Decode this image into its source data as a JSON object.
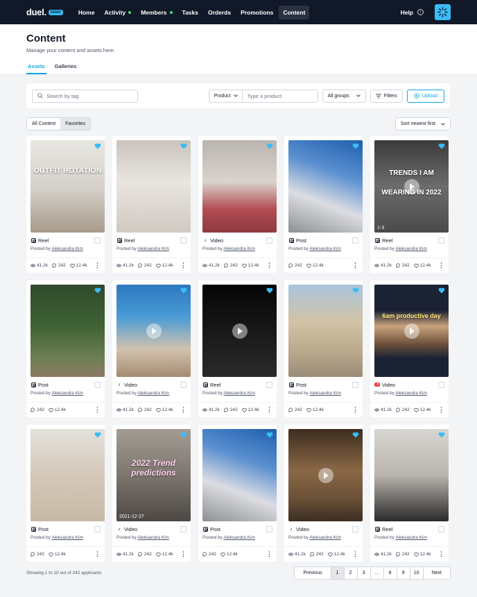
{
  "nav": {
    "logo": "duel.",
    "badge": "DEMO",
    "items": [
      {
        "label": "Home",
        "dot": false,
        "active": false
      },
      {
        "label": "Activity",
        "dot": true,
        "active": false
      },
      {
        "label": "Members",
        "dot": true,
        "active": false
      },
      {
        "label": "Tasks",
        "dot": false,
        "active": false
      },
      {
        "label": "Orderds",
        "dot": false,
        "active": false
      },
      {
        "label": "Promotions",
        "dot": false,
        "active": false
      },
      {
        "label": "Content",
        "dot": false,
        "active": true
      }
    ],
    "help": "Help"
  },
  "header": {
    "title": "Content",
    "subtitle": "Manage your content and assets here.",
    "tabs": [
      {
        "label": "Assets",
        "active": true
      },
      {
        "label": "Galleries",
        "active": false
      }
    ]
  },
  "filters": {
    "search_placeholder": "Search by tag",
    "product_label": "Product",
    "product_placeholder": "Type a product",
    "groups_label": "All groups",
    "filters_label": "Filters",
    "upload_label": "Upload"
  },
  "toggle": {
    "all": "All Content",
    "favorites": "Favorites"
  },
  "sort": {
    "label": "Sort newest first"
  },
  "posted_prefix": "Posted by",
  "cards": [
    {
      "type": "Reel",
      "platform": "instagram",
      "author": "Aleksandra Kim",
      "views": "41.2k",
      "comments": "242",
      "likes": "12.4k",
      "overlay": "OUTFIT ROTATION",
      "corner": "",
      "play": false,
      "bg": "linear-gradient(180deg,#e8e6e2 0%,#d6d2cb 50%,#a89c8c 100%)"
    },
    {
      "type": "Reel",
      "platform": "instagram",
      "author": "Aleksandra Kim",
      "views": "41.2k",
      "comments": "242",
      "likes": "12.4k",
      "overlay": "",
      "corner": "",
      "play": false,
      "bg": "linear-gradient(180deg,#c9c3bc 0%,#e9e5df 45%,#cfc9c1 100%)"
    },
    {
      "type": "Video",
      "platform": "tiktok",
      "author": "Aleksandra Kim",
      "views": "41.2k",
      "comments": "242",
      "likes": "12.4k",
      "overlay": "",
      "corner": "",
      "play": false,
      "bg": "linear-gradient(180deg,#b9b4ae 0%,#d9d3cc 45%,#b24c52 75%,#8e3a40 100%)"
    },
    {
      "type": "Post",
      "platform": "instagram",
      "author": "Aleksandra Kim",
      "views": "",
      "comments": "242",
      "likes": "12.4k",
      "overlay": "",
      "corner": "",
      "play": false,
      "bg": "linear-gradient(200deg,#1f5fae 0%,#5b90d0 35%,#dcdde2 65%,#8c8f93 100%)"
    },
    {
      "type": "Reel",
      "platform": "instagram",
      "author": "Aleksandra Kim",
      "views": "41.2k",
      "comments": "242",
      "likes": "12.4k",
      "overlay": "TRENDS I AM WEARING IN 2022",
      "corner": "1-3",
      "play": true,
      "bg": "linear-gradient(180deg,#3b3b3b 0%,#6c6c6c 50%,#4a4a4a 100%)"
    },
    {
      "type": "Post",
      "platform": "instagram",
      "author": "Aleksandra Kim",
      "views": "",
      "comments": "242",
      "likes": "12.4k",
      "overlay": "",
      "corner": "",
      "play": false,
      "bg": "linear-gradient(180deg,#2f4a2b 0%,#3f6234 45%,#6e7f55 80%,#8c7a62 100%)"
    },
    {
      "type": "Video",
      "platform": "tiktok",
      "author": "Aleksandra Kim",
      "views": "41.2k",
      "comments": "242",
      "likes": "12.4k",
      "overlay": "",
      "corner": "",
      "play": true,
      "bg": "linear-gradient(180deg,#2d78c0 0%,#4a9bd6 35%,#d2c2ae 70%,#a48b71 100%)"
    },
    {
      "type": "Reel",
      "platform": "instagram",
      "author": "Aleksandra Kim",
      "views": "41.2k",
      "comments": "242",
      "likes": "12.4k",
      "overlay": "",
      "corner": "",
      "play": true,
      "bg": "linear-gradient(180deg,#050505 0%,#1a1a1a 55%,#2a2a2a 100%)"
    },
    {
      "type": "Post",
      "platform": "instagram",
      "author": "Aleksandra Kim",
      "views": "",
      "comments": "242",
      "likes": "12.4k",
      "overlay": "",
      "corner": "",
      "play": false,
      "bg": "linear-gradient(180deg,#a9c4dc 0%,#d2c3a6 40%,#b7a68a 75%,#9a8c78 100%)"
    },
    {
      "type": "Video",
      "platform": "youtube",
      "author": "Aleksandra Kim",
      "views": "41.2k",
      "comments": "242",
      "likes": "12.4k",
      "overlay": "6am productive day",
      "corner": "",
      "play": true,
      "bg": "linear-gradient(180deg,#1b2233 0%,#1b2233 28%,#c9a27d 45%,#6a4e3a 65%,#1b2233 80%,#1b2233 100%)"
    },
    {
      "type": "Post",
      "platform": "instagram",
      "author": "Aleksandra Kim",
      "views": "",
      "comments": "242",
      "likes": "12.4k",
      "overlay": "",
      "corner": "",
      "play": false,
      "bg": "linear-gradient(180deg,#e4e1dc 0%,#d4c8b9 50%,#c7b9a6 100%)"
    },
    {
      "type": "Video",
      "platform": "tiktok",
      "author": "Aleksandra Kim",
      "views": "41.2k",
      "comments": "242",
      "likes": "12.4k",
      "overlay": "2022 Trend predictions",
      "corner": "2021-12-27",
      "play": false,
      "bg": "linear-gradient(180deg,#a39c94 0%,#7d766f 50%,#4d4844 100%)"
    },
    {
      "type": "Post",
      "platform": "instagram",
      "author": "Aleksandra Kim",
      "views": "",
      "comments": "242",
      "likes": "12.4k",
      "overlay": "",
      "corner": "",
      "play": false,
      "bg": "linear-gradient(200deg,#1f5fae 0%,#5b90d0 35%,#dcdde2 65%,#8c8f93 100%)"
    },
    {
      "type": "Video",
      "platform": "tiktok",
      "author": "Aleksandra Kim",
      "views": "41.2k",
      "comments": "242",
      "likes": "12.4k",
      "overlay": "",
      "corner": "",
      "play": true,
      "bg": "linear-gradient(180deg,#3d2c20 0%,#8a6846 45%,#6b5136 75%,#3b2e24 100%)"
    },
    {
      "type": "Reel",
      "platform": "instagram",
      "author": "Aleksandra Kim",
      "views": "41.2k",
      "comments": "242",
      "likes": "12.4k",
      "overlay": "",
      "corner": "",
      "play": false,
      "bg": "linear-gradient(180deg,#d8d6d2 0%,#b9b4ad 50%,#2a2a2a 100%)"
    }
  ],
  "footer": {
    "showing": "Showing 1 to 10 out of 242 applicants",
    "pages": [
      "Previous",
      "1",
      "2",
      "3",
      "...",
      "8",
      "9",
      "10",
      "Next"
    ],
    "current": "1"
  },
  "colors": {
    "accent": "#0ea5e9",
    "nav_bg": "#111827",
    "heart": "#38bdf8"
  }
}
